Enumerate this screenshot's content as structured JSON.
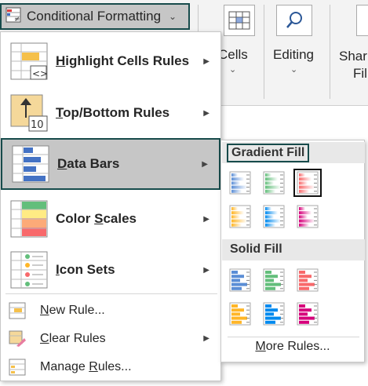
{
  "ribbon": {
    "conditional_formatting": {
      "label": "Conditional Formatting",
      "chevron": "⌄"
    },
    "cells": {
      "label": "Cells",
      "chevron": "⌄"
    },
    "editing": {
      "label": "Editing",
      "chevron": "⌄"
    },
    "share": {
      "label": "Shar",
      "label2": "Fil"
    }
  },
  "menu": {
    "items": [
      {
        "pre": "",
        "key": "H",
        "post": "ighlight Cells Rules",
        "icon": "highlight-cells-icon",
        "arrow": "›"
      },
      {
        "pre": "",
        "key": "T",
        "post": "op/Bottom Rules",
        "icon": "top-bottom-icon",
        "icon_text": "10",
        "arrow": "›"
      },
      {
        "pre": "",
        "key": "D",
        "post": "ata Bars",
        "icon": "data-bars-icon",
        "arrow": "›",
        "selected": true
      },
      {
        "pre": "Color ",
        "key": "S",
        "post": "cales",
        "icon": "color-scales-icon",
        "arrow": "›"
      },
      {
        "pre": "",
        "key": "I",
        "post": "con Sets",
        "icon": "icon-sets-icon",
        "arrow": "›"
      }
    ],
    "small_items": [
      {
        "pre": "",
        "key": "N",
        "post": "ew Rule...",
        "icon": "new-rule-icon"
      },
      {
        "pre": "",
        "key": "C",
        "post": "lear Rules",
        "icon": "clear-rules-icon",
        "arrow": "›"
      },
      {
        "pre": "Manage ",
        "key": "R",
        "post": "ules...",
        "icon": "manage-rules-icon"
      }
    ]
  },
  "submenu": {
    "gradient_fill": "Gradient Fill",
    "solid_fill": "Solid Fill",
    "more_rules": {
      "pre": "",
      "key": "M",
      "post": "ore Rules..."
    },
    "gradient_colors": [
      "#5b8ed6",
      "#63be7b",
      "#f8696b",
      "#ffb628",
      "#008aef",
      "#d6007b"
    ],
    "solid_colors": [
      "#5b8ed6",
      "#63be7b",
      "#f8696b",
      "#ffb628",
      "#008aef",
      "#d6007b"
    ],
    "selected_gradient": 2
  }
}
